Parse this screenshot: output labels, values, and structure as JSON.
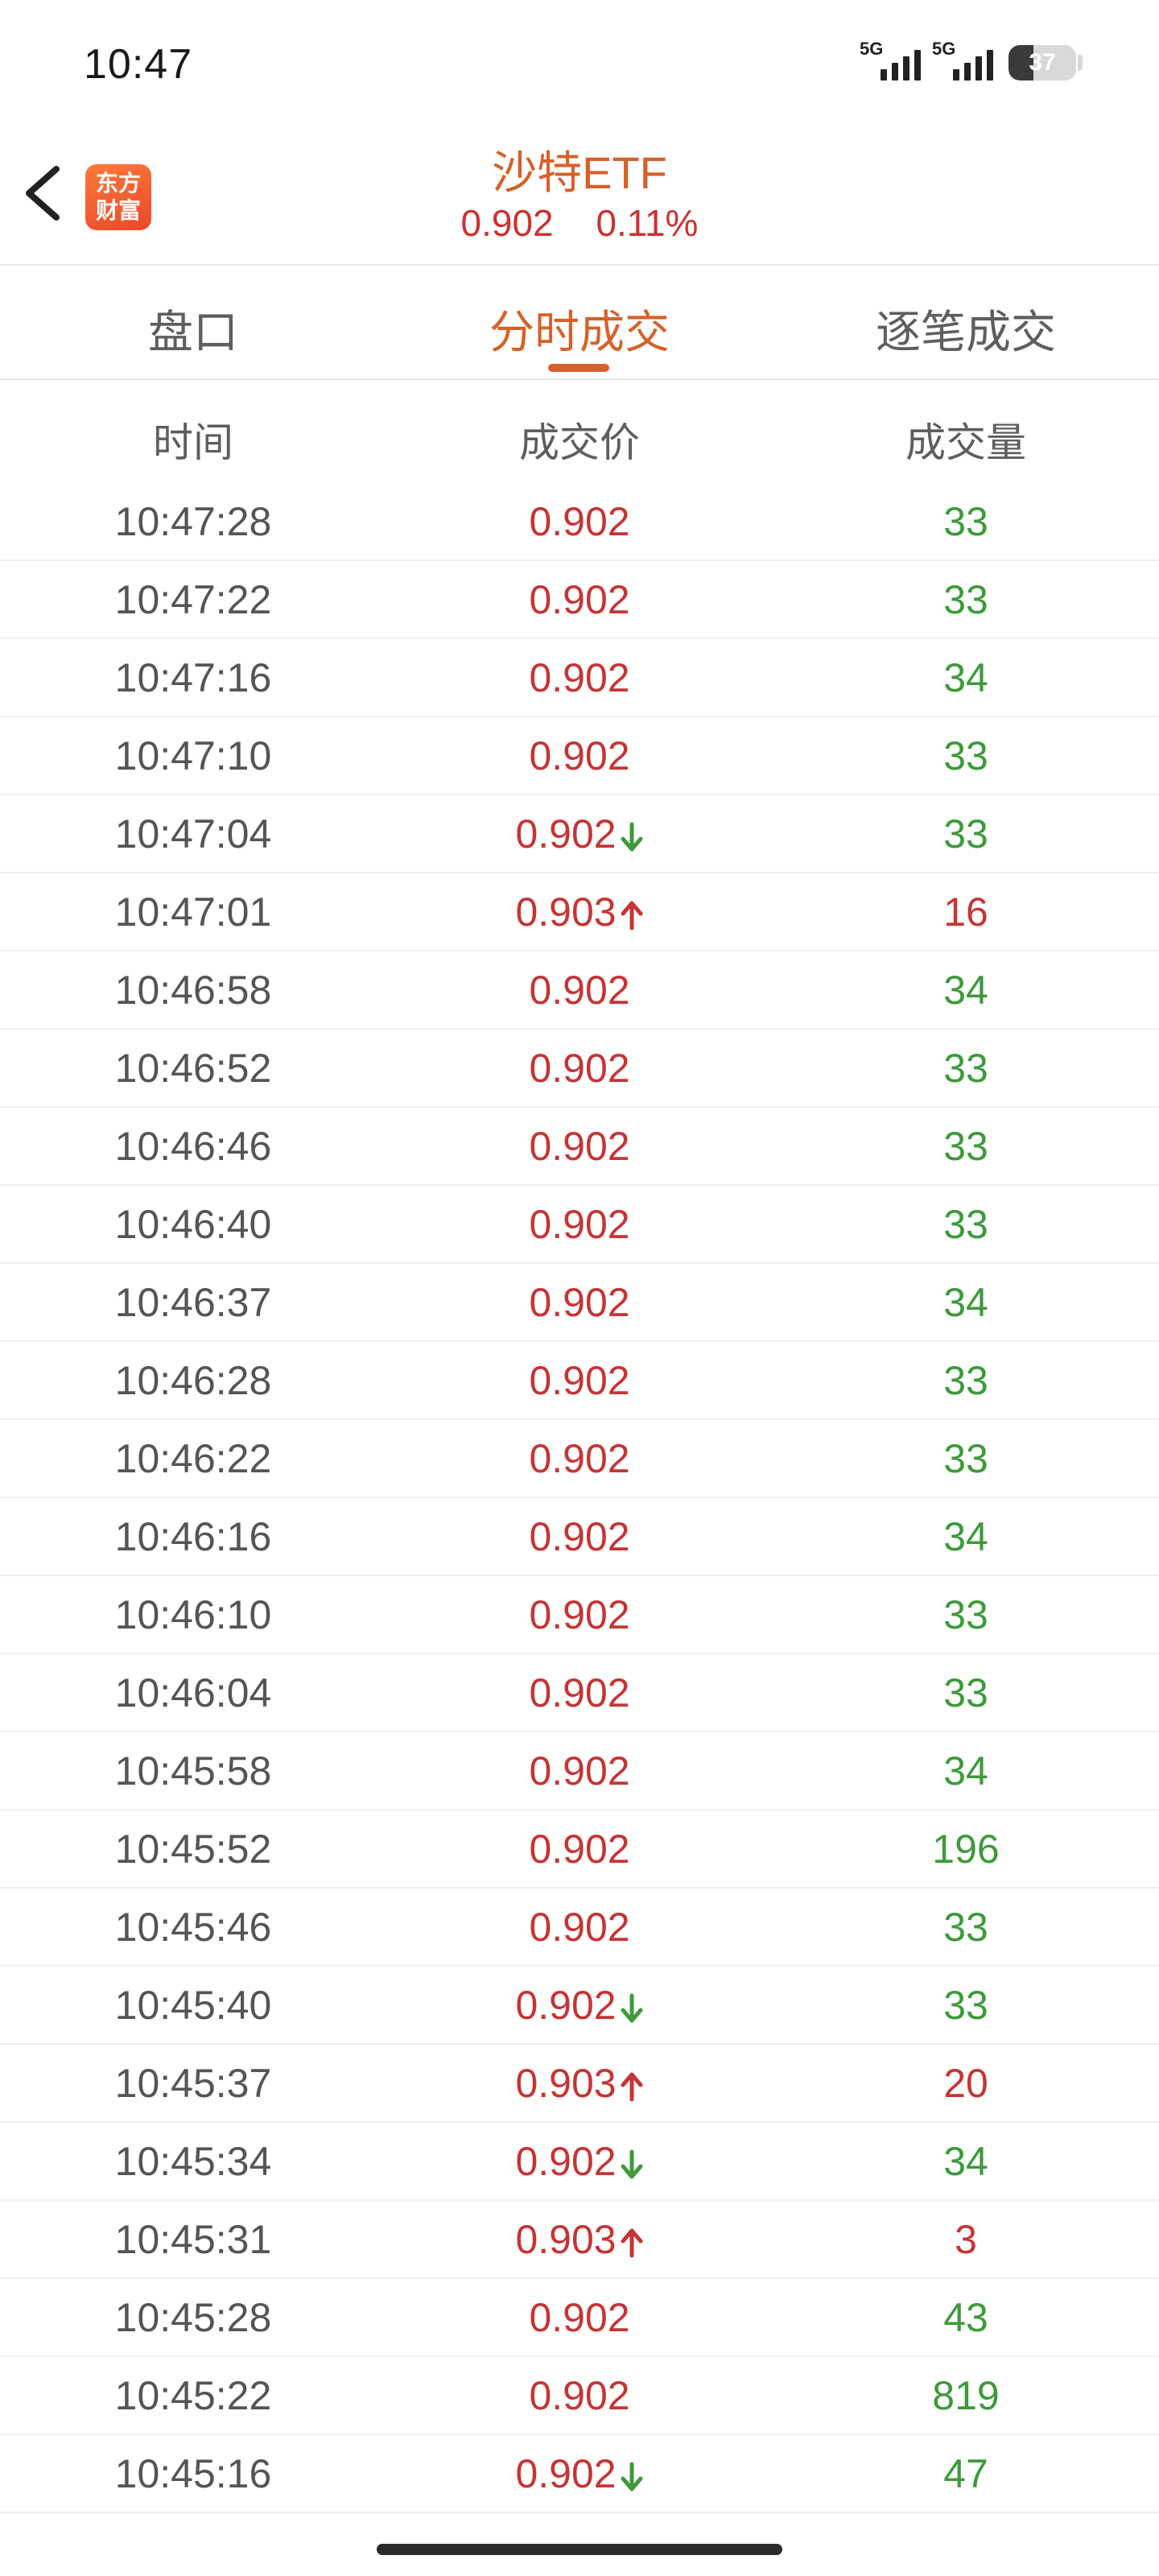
{
  "status_bar": {
    "time": "10:47",
    "signal1_label": "5G",
    "signal2_label": "5G",
    "battery": "37",
    "battery_level": 0.37
  },
  "header": {
    "logo_text_line1": "东方",
    "logo_text_line2": "财富",
    "title": "沙特ETF",
    "price": "0.902",
    "change": "0.11%"
  },
  "tabs": [
    {
      "label": "盘口",
      "active": false
    },
    {
      "label": "分时成交",
      "active": true
    },
    {
      "label": "逐笔成交",
      "active": false
    }
  ],
  "table": {
    "headers": [
      "时间",
      "成交价",
      "成交量"
    ],
    "rows": [
      {
        "time": "10:47:28",
        "price": "0.902",
        "arrow": "",
        "volume": "33",
        "side": "sell"
      },
      {
        "time": "10:47:22",
        "price": "0.902",
        "arrow": "",
        "volume": "33",
        "side": "sell"
      },
      {
        "time": "10:47:16",
        "price": "0.902",
        "arrow": "",
        "volume": "34",
        "side": "sell"
      },
      {
        "time": "10:47:10",
        "price": "0.902",
        "arrow": "",
        "volume": "33",
        "side": "sell"
      },
      {
        "time": "10:47:04",
        "price": "0.902",
        "arrow": "down",
        "volume": "33",
        "side": "sell"
      },
      {
        "time": "10:47:01",
        "price": "0.903",
        "arrow": "up",
        "volume": "16",
        "side": "buy"
      },
      {
        "time": "10:46:58",
        "price": "0.902",
        "arrow": "",
        "volume": "34",
        "side": "sell"
      },
      {
        "time": "10:46:52",
        "price": "0.902",
        "arrow": "",
        "volume": "33",
        "side": "sell"
      },
      {
        "time": "10:46:46",
        "price": "0.902",
        "arrow": "",
        "volume": "33",
        "side": "sell"
      },
      {
        "time": "10:46:40",
        "price": "0.902",
        "arrow": "",
        "volume": "33",
        "side": "sell"
      },
      {
        "time": "10:46:37",
        "price": "0.902",
        "arrow": "",
        "volume": "34",
        "side": "sell"
      },
      {
        "time": "10:46:28",
        "price": "0.902",
        "arrow": "",
        "volume": "33",
        "side": "sell"
      },
      {
        "time": "10:46:22",
        "price": "0.902",
        "arrow": "",
        "volume": "33",
        "side": "sell"
      },
      {
        "time": "10:46:16",
        "price": "0.902",
        "arrow": "",
        "volume": "34",
        "side": "sell"
      },
      {
        "time": "10:46:10",
        "price": "0.902",
        "arrow": "",
        "volume": "33",
        "side": "sell"
      },
      {
        "time": "10:46:04",
        "price": "0.902",
        "arrow": "",
        "volume": "33",
        "side": "sell"
      },
      {
        "time": "10:45:58",
        "price": "0.902",
        "arrow": "",
        "volume": "34",
        "side": "sell"
      },
      {
        "time": "10:45:52",
        "price": "0.902",
        "arrow": "",
        "volume": "196",
        "side": "sell"
      },
      {
        "time": "10:45:46",
        "price": "0.902",
        "arrow": "",
        "volume": "33",
        "side": "sell"
      },
      {
        "time": "10:45:40",
        "price": "0.902",
        "arrow": "down",
        "volume": "33",
        "side": "sell"
      },
      {
        "time": "10:45:37",
        "price": "0.903",
        "arrow": "up",
        "volume": "20",
        "side": "buy"
      },
      {
        "time": "10:45:34",
        "price": "0.902",
        "arrow": "down",
        "volume": "34",
        "side": "sell"
      },
      {
        "time": "10:45:31",
        "price": "0.903",
        "arrow": "up",
        "volume": "3",
        "side": "buy"
      },
      {
        "time": "10:45:28",
        "price": "0.902",
        "arrow": "",
        "volume": "43",
        "side": "sell"
      },
      {
        "time": "10:45:22",
        "price": "0.902",
        "arrow": "",
        "volume": "819",
        "side": "sell"
      },
      {
        "time": "10:45:16",
        "price": "0.902",
        "arrow": "down",
        "volume": "47",
        "side": "sell"
      }
    ]
  },
  "colors": {
    "accent": "#d6612a",
    "up": "#c53535",
    "down": "#3e9a3b"
  }
}
